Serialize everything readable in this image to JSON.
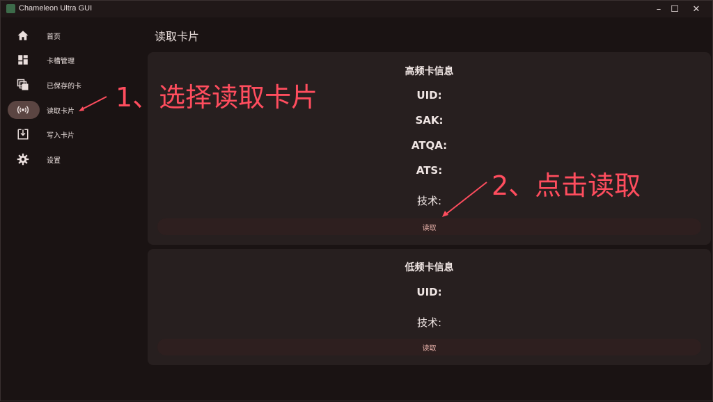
{
  "window": {
    "title": "Chameleon Ultra GUI",
    "controls": {
      "minimize": "–",
      "maximize": "☐",
      "close": "✕"
    }
  },
  "sidebar": {
    "items": [
      {
        "label": "首页",
        "icon": "home-icon"
      },
      {
        "label": "卡槽管理",
        "icon": "dashboard-icon"
      },
      {
        "label": "已保存的卡",
        "icon": "saved-cards-icon"
      },
      {
        "label": "读取卡片",
        "icon": "broadcast-icon",
        "active": true
      },
      {
        "label": "写入卡片",
        "icon": "download-icon"
      },
      {
        "label": "设置",
        "icon": "gear-icon"
      }
    ]
  },
  "main": {
    "title": "读取卡片",
    "hf_card": {
      "heading": "高频卡信息",
      "uid": "UID:",
      "sak": "SAK:",
      "atqa": "ATQA:",
      "ats": "ATS:",
      "tech": "技术:",
      "read_button": "读取"
    },
    "lf_card": {
      "heading": "低频卡信息",
      "uid": "UID:",
      "tech": "技术:",
      "read_button": "读取"
    }
  },
  "annotations": {
    "step1": "1、选择读取卡片",
    "step2": "2、点击读取",
    "color": "#ff4d5e"
  },
  "colors": {
    "background": "#1a1313",
    "card": "#271f1f",
    "active_pill": "#5b4542",
    "button_text": "#f1b8b0"
  }
}
